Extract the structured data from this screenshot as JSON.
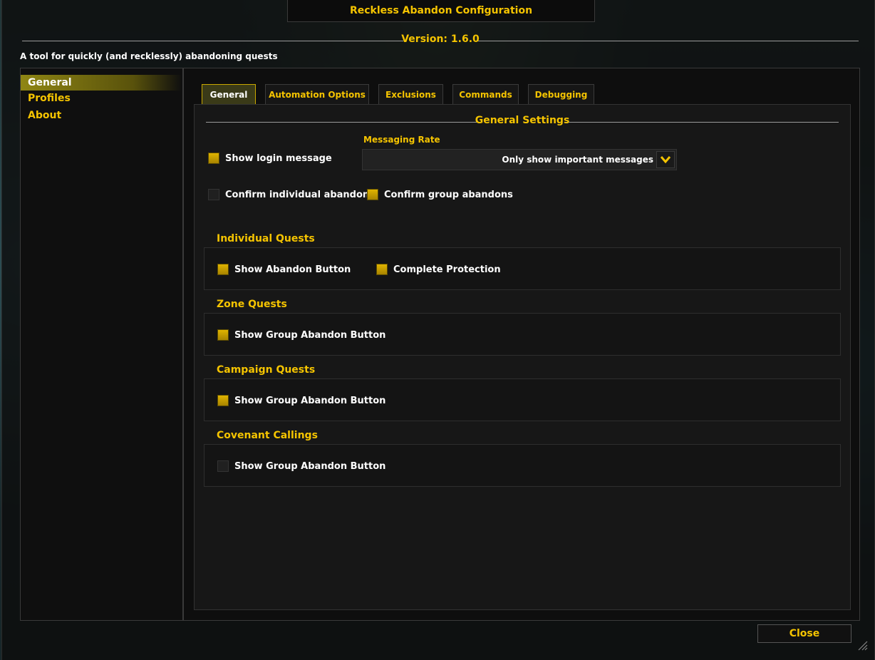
{
  "window": {
    "title": "Reckless Abandon Configuration",
    "version_label": "Version: 1.6.0",
    "tagline": "A tool for quickly (and recklessly) abandoning quests"
  },
  "sidebar": {
    "items": [
      {
        "label": "General",
        "active": true
      },
      {
        "label": "Profiles",
        "active": false
      },
      {
        "label": "About",
        "active": false
      }
    ]
  },
  "tabs": [
    {
      "label": "General",
      "active": true
    },
    {
      "label": "Automation Options",
      "active": false
    },
    {
      "label": "Exclusions",
      "active": false
    },
    {
      "label": "Commands",
      "active": false
    },
    {
      "label": "Debugging",
      "active": false
    }
  ],
  "general_settings": {
    "title": "General Settings",
    "show_login_message": {
      "label": "Show login message",
      "checked": true
    },
    "messaging_rate": {
      "label": "Messaging Rate",
      "value": "Only show important messages"
    },
    "confirm_individual": {
      "label": "Confirm individual abandons",
      "checked": false
    },
    "confirm_group": {
      "label": "Confirm group abandons",
      "checked": true
    }
  },
  "groups": {
    "individual": {
      "title": "Individual Quests",
      "show_abandon": {
        "label": "Show Abandon Button",
        "checked": true
      },
      "complete_protection": {
        "label": "Complete Protection",
        "checked": true
      }
    },
    "zone": {
      "title": "Zone Quests",
      "show_group_abandon": {
        "label": "Show Group Abandon Button",
        "checked": true
      }
    },
    "campaign": {
      "title": "Campaign Quests",
      "show_group_abandon": {
        "label": "Show Group Abandon Button",
        "checked": true
      }
    },
    "covenant": {
      "title": "Covenant Callings",
      "show_group_abandon": {
        "label": "Show Group Abandon Button",
        "checked": false
      }
    }
  },
  "footer": {
    "close_label": "Close"
  },
  "colors": {
    "accent": "#f5c400",
    "text": "#ffffff",
    "panel": "#0e0e0e"
  }
}
